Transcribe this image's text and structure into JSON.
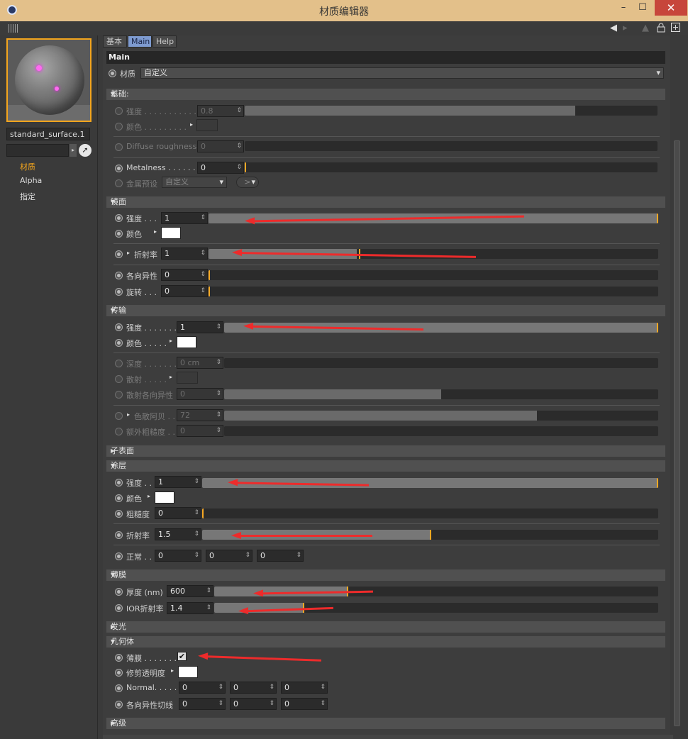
{
  "window": {
    "title": "材质编辑器",
    "min": "–",
    "max": "☐",
    "close": "✕"
  },
  "toolbar": {
    "back": "◀",
    "forward": "▸",
    "up": "▲",
    "lock": "🔒",
    "new": "⊞"
  },
  "left": {
    "material_name": "standard_surface.1",
    "arrow": "▸",
    "picker": "➚",
    "nav": [
      {
        "label": "材质",
        "active": true
      },
      {
        "label": "Alpha",
        "active": false
      },
      {
        "label": "指定",
        "active": false
      }
    ]
  },
  "tabs": [
    {
      "label": "基本"
    },
    {
      "label": "Main"
    },
    {
      "label": "Help"
    }
  ],
  "main_header": "Main",
  "material": {
    "label": "材质",
    "value": "自定义"
  },
  "sections": {
    "base": "基础:",
    "specular": "镜面",
    "transmission": "传输",
    "subsurface": "子表面",
    "coat": "涂层",
    "thinfilm": "薄膜",
    "emission": "发光",
    "geometry": "几何体",
    "advanced": "高级"
  },
  "base": {
    "intensity_label": "强度 . . . . . . . . . . . .",
    "intensity": "0.8",
    "intensity_fill": 0.8,
    "color_label": "颜色 . . . . . . . . .",
    "diffuse_roughness_label": "Diffuse roughness",
    "diffuse_roughness": "0",
    "metalness_label": "Metalness . . . . . . .",
    "metalness": "0",
    "metal_preset_label": "金属预设",
    "metal_preset": "自定义",
    "metal_preset_btn": ">"
  },
  "specular": {
    "intensity_label": "强度 . . .",
    "intensity": "1",
    "intensity_fill": 1.0,
    "color_label": "颜色",
    "ior_label": "折射率",
    "ior": "1",
    "ior_fill": 0.33,
    "anisotropy_label": "各向异性",
    "anisotropy": "0",
    "rotation_label": "旋转 . . .",
    "rotation": "0"
  },
  "transmission": {
    "intensity_label": "强度 . . . . . . .",
    "intensity": "1",
    "intensity_fill": 1.0,
    "color_label": "颜色 . . . . .",
    "depth_label": "深度 . . . . . . .",
    "depth": "0 cm",
    "scatter_label": "散射 . . . . .",
    "scatter_anisotropy_label": "散射各向异性",
    "scatter_anisotropy": "0",
    "scatter_anisotropy_fill": 0.5,
    "dispersion_label": "色散阿贝 . .",
    "dispersion": "72",
    "dispersion_fill": 0.72,
    "extra_roughness_label": "额外粗糙度 . .",
    "extra_roughness": "0"
  },
  "coat": {
    "intensity_label": "强度 . .",
    "intensity": "1",
    "intensity_fill": 1.0,
    "color_label": "颜色",
    "roughness_label": "粗糙度",
    "roughness": "0",
    "ior_label": "折射率",
    "ior": "1.5",
    "ior_fill": 0.5,
    "normal_label": "正常 . .",
    "normal": [
      "0",
      "0",
      "0"
    ]
  },
  "thinfilm": {
    "thickness_label": "厚度 (nm)",
    "thickness": "600",
    "thickness_fill": 0.3,
    "ior_label": "IOR折射率",
    "ior": "1.4",
    "ior_fill": 0.2
  },
  "geometry": {
    "thin_walled_label": "薄膜 . . . . . . .",
    "thin_walled": "✔",
    "opacity_label": "修剪透明度",
    "normal_label": "Normal. . . . .",
    "normal": [
      "0",
      "0",
      "0"
    ],
    "tangent_label": "各向异性切线",
    "tangent": [
      "0",
      "0",
      "0"
    ]
  },
  "colors": {
    "accent": "#f3a51d",
    "annotation": "#ed2b2b",
    "titlebar": "#e3c08a",
    "tab_active": "#7e9bd0"
  }
}
